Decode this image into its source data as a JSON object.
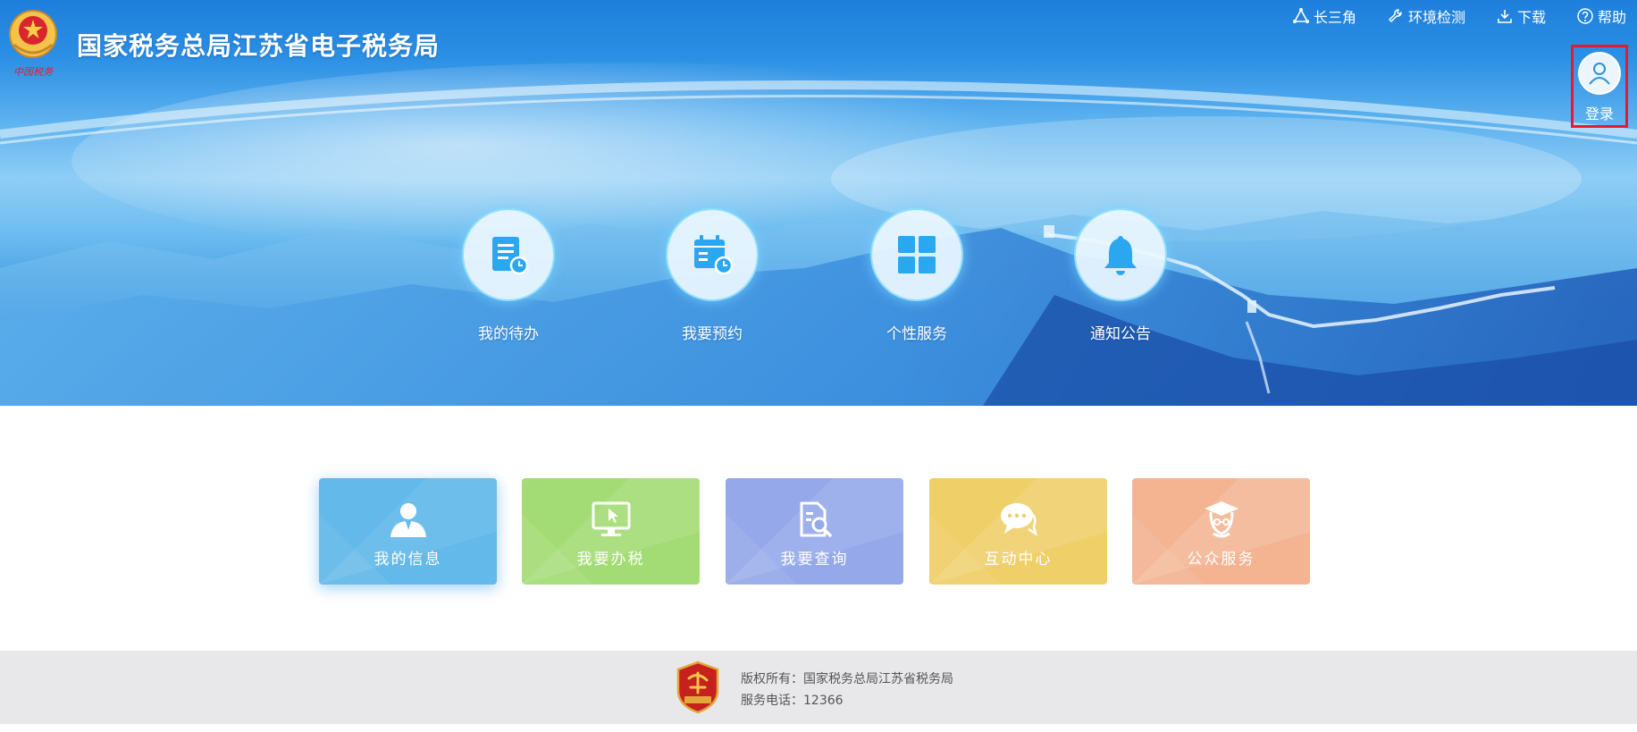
{
  "header": {
    "site_title": "国家税务总局江苏省电子税务局"
  },
  "topnav": [
    {
      "label": "长三角",
      "icon": "triangle-network-icon"
    },
    {
      "label": "环境检测",
      "icon": "wrench-icon"
    },
    {
      "label": "下载",
      "icon": "download-icon"
    },
    {
      "label": "帮助",
      "icon": "help-circle-icon"
    }
  ],
  "login": {
    "label": "登录",
    "icon": "user-avatar-icon"
  },
  "quick_links": [
    {
      "label": "我的待办",
      "icon": "todo-document-icon"
    },
    {
      "label": "我要预约",
      "icon": "calendar-clock-icon"
    },
    {
      "label": "个性服务",
      "icon": "grid-apps-icon"
    },
    {
      "label": "通知公告",
      "icon": "bell-icon"
    }
  ],
  "tiles": [
    {
      "label": "我的信息",
      "icon": "user-icon",
      "color": "#62b9ea"
    },
    {
      "label": "我要办税",
      "icon": "monitor-cursor-icon",
      "color": "#a3dc74"
    },
    {
      "label": "我要查询",
      "icon": "document-search-icon",
      "color": "#95a9ea"
    },
    {
      "label": "互动中心",
      "icon": "chat-bubble-icon",
      "color": "#efcf67"
    },
    {
      "label": "公众服务",
      "icon": "graduate-icon",
      "color": "#f4b492"
    }
  ],
  "footer": {
    "copyright": "版权所有：国家税务总局江苏省税务局",
    "phone": "服务电话：12366",
    "badge_icon": "party-badge-icon"
  },
  "colors": {
    "banner_blue": "#1e7fdc",
    "login_highlight": "#e8192c",
    "quick_icon_blue": "#2aa7ef",
    "footer_bg": "#e8e8ea"
  }
}
